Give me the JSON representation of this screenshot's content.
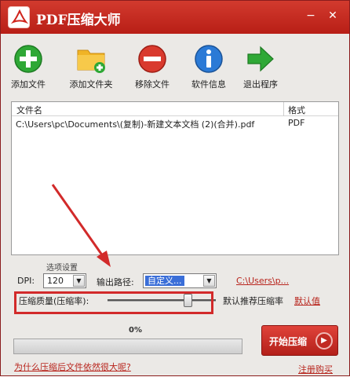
{
  "window": {
    "title": "PDF压缩大师",
    "minimize": "−",
    "close": "✕"
  },
  "toolbar": [
    {
      "label": "添加文件",
      "icon": "add-file-icon",
      "color": "#2fa836"
    },
    {
      "label": "添加文件夹",
      "icon": "add-folder-icon",
      "color": "#f0b426"
    },
    {
      "label": "移除文件",
      "icon": "remove-file-icon",
      "color": "#d93a2e"
    },
    {
      "label": "软件信息",
      "icon": "info-icon",
      "color": "#2b7ad6"
    },
    {
      "label": "退出程序",
      "icon": "exit-arrow-icon",
      "color": "#2fa836"
    }
  ],
  "filelist": {
    "headers": [
      "文件名",
      "格式"
    ],
    "rows": [
      {
        "name": "C:\\Users\\pc\\Documents\\(复制)-新建文本文档 (2)(合并).pdf",
        "format": "PDF"
      }
    ]
  },
  "settings": {
    "title": "选项设置",
    "dpi_label": "DPI:",
    "dpi_value": "120",
    "output_label": "输出路径:",
    "output_value": "自定义...",
    "output_path_link": "C:\\Users\\p...",
    "quality_label": "压缩质量(压缩率):",
    "quality_level": 0.75,
    "recommend_text": "默认推荐压缩率",
    "default_link": "默认值"
  },
  "progress": {
    "text": "0%",
    "value": 0
  },
  "start_button": "开始压缩",
  "start_button_icon": "▶",
  "footer": {
    "help_link": "为什么压缩后文件依然很大呢?",
    "register_link": "注册购买"
  },
  "colors": {
    "brand": "#c72a22",
    "annotation": "#d22a2a"
  }
}
